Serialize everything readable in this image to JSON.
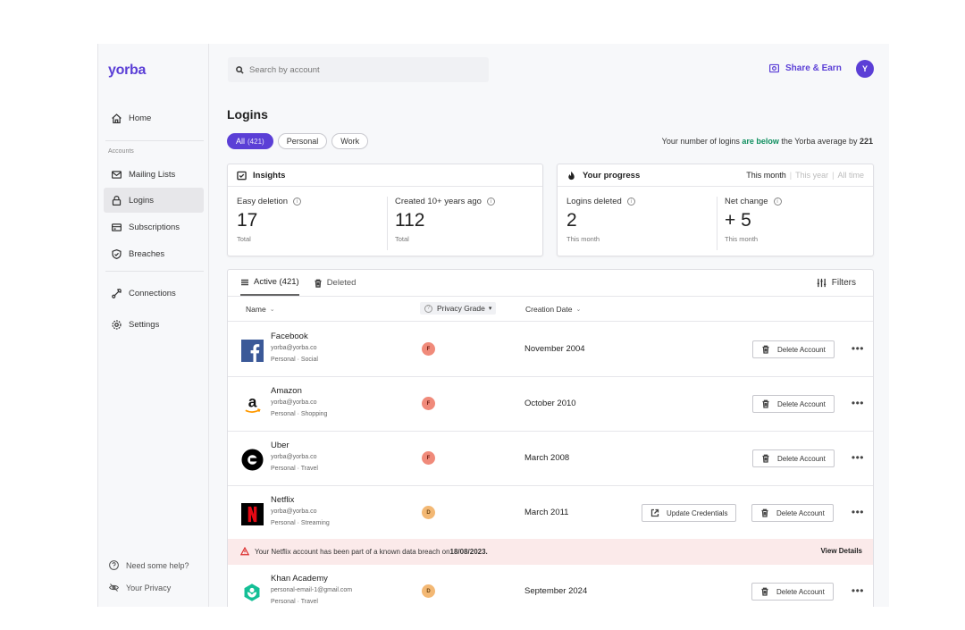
{
  "app": {
    "logo": "yorba"
  },
  "sidebar": {
    "home": "Home",
    "section_label": "Accounts",
    "items": [
      {
        "label": "Mailing Lists"
      },
      {
        "label": "Logins"
      },
      {
        "label": "Subscriptions"
      },
      {
        "label": "Breaches"
      }
    ],
    "connections": "Connections",
    "settings": "Settings",
    "help": "Need some help?",
    "privacy": "Your Privacy"
  },
  "header": {
    "search_placeholder": "Search by account",
    "share_label": "Share & Earn",
    "avatar_initial": "Y"
  },
  "page": {
    "title": "Logins",
    "filters": [
      {
        "label": "All",
        "count": "(421)"
      },
      {
        "label": "Personal"
      },
      {
        "label": "Work"
      }
    ],
    "avg_note_prefix": "Your number of logins ",
    "avg_note_good": "are below",
    "avg_note_suffix": " the Yorba average by ",
    "avg_note_value": "221"
  },
  "insights": {
    "title": "Insights",
    "easy_deletion": {
      "label": "Easy deletion",
      "value": "17",
      "sub": "Total"
    },
    "created_old": {
      "label": "Created 10+ years ago",
      "value": "112",
      "sub": "Total"
    }
  },
  "progress": {
    "title": "Your progress",
    "ranges": [
      "This month",
      "This year",
      "All time"
    ],
    "logins_deleted": {
      "label": "Logins deleted",
      "value": "2",
      "sub": "This month"
    },
    "net_change": {
      "label": "Net change",
      "value": "+ 5",
      "sub": "This month"
    }
  },
  "table": {
    "tab_active": "Active (421)",
    "tab_deleted": "Deleted",
    "filters_label": "Filters",
    "col_name": "Name",
    "col_grade": "Privacy Grade",
    "col_date": "Creation Date",
    "delete_label": "Delete Account",
    "update_label": "Update Credentials",
    "rows": [
      {
        "name": "Facebook",
        "email": "yorba@yorba.co",
        "tags": "Personal  ·  Social",
        "grade": "F",
        "date": "November 2004"
      },
      {
        "name": "Amazon",
        "email": "yorba@yorba.co",
        "tags": "Personal  ·  Shopping",
        "grade": "F",
        "date": "October 2010"
      },
      {
        "name": "Uber",
        "email": "yorba@yorba.co",
        "tags": "Personal  ·  Travel",
        "grade": "F",
        "date": "March 2008"
      },
      {
        "name": "Netflix",
        "email": "yorba@yorba.co",
        "tags": "Personal  ·  Streaming",
        "grade": "D",
        "date": "March 2011"
      },
      {
        "name": "Khan Academy",
        "email": "personal-email-1@gmail.com",
        "tags": "Personal  ·  Travel",
        "grade": "D",
        "date": "September 2024"
      }
    ],
    "alert_prefix": "Your Netflix account has been part of a known data breach on ",
    "alert_date": "18/08/2023.",
    "alert_action": "View Details"
  },
  "colors": {
    "brand": "#5b3fd6",
    "good": "#0f8f5f",
    "grade_f": "#f08a7a",
    "grade_d": "#f3b874",
    "alert_bg": "#fbeaea"
  }
}
